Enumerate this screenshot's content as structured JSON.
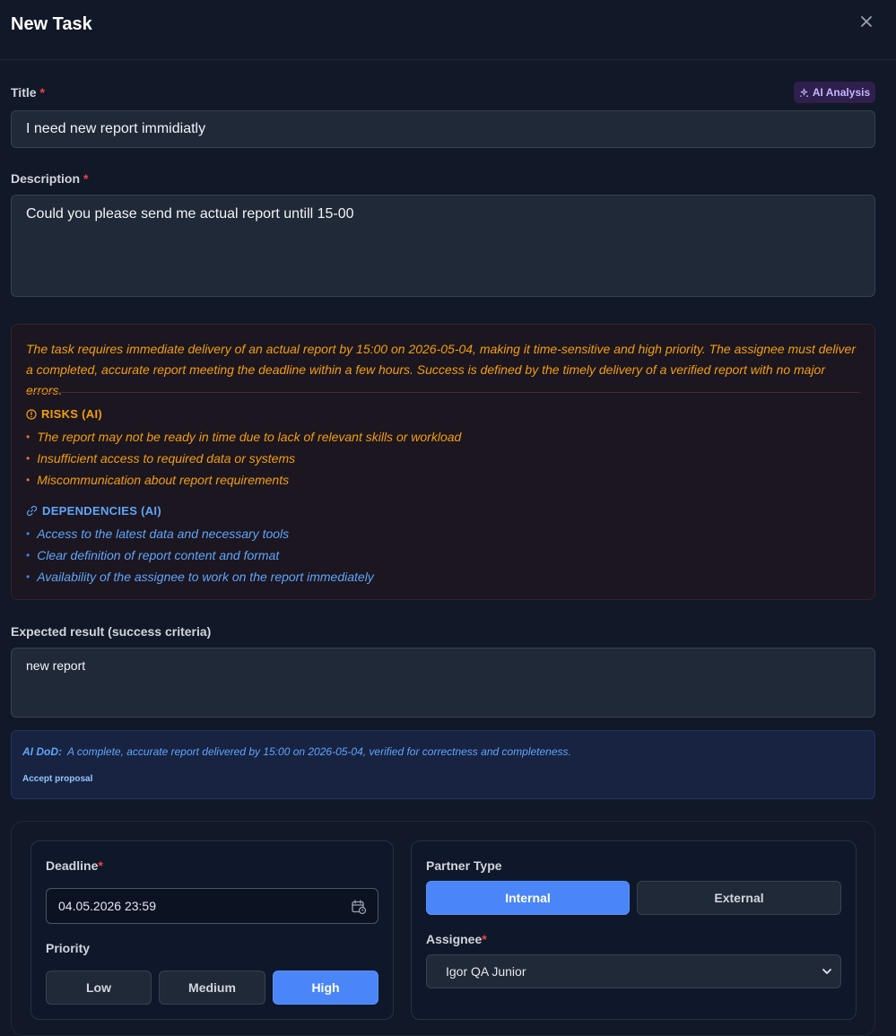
{
  "dialog": {
    "title": "New Task"
  },
  "form": {
    "title_label": "Title",
    "required_mark": "*",
    "ai_button_label": "AI Analysis",
    "title_value": "I need new report immidiatly",
    "description_label": "Description",
    "description_value": "Could you please send me actual report untill 15-00",
    "expected_label": "Expected result (success criteria)",
    "expected_value": "new report"
  },
  "analysis": {
    "summary": "The task requires immediate delivery of an actual report by 15:00 on 2026-05-04, making it time-sensitive and high priority. The assignee must deliver a completed, accurate report meeting the deadline within a few hours. Success is defined by the timely delivery of a verified report with no major errors.",
    "risks_title": "RISKS (AI)",
    "risks": [
      "The report may not be ready in time due to lack of relevant skills or workload",
      "Insufficient access to required data or systems",
      "Miscommunication about report requirements"
    ],
    "dependencies_title": "DEPENDENCIES (AI)",
    "dependencies": [
      "Access to the latest data and necessary tools",
      "Clear definition of report content and format",
      "Availability of the assignee to work on the report immediately"
    ],
    "bullet": "•"
  },
  "dod": {
    "label": "AI DoD:",
    "text": "A complete, accurate report delivered by 15:00 on 2026-05-04, verified for correctness and completeness.",
    "accept_label": "Accept proposal"
  },
  "settings": {
    "deadline_label": "Deadline",
    "deadline_value": "04.05.2026 23:59",
    "priority_label": "Priority",
    "priority_options": [
      "Low",
      "Medium",
      "High"
    ],
    "priority_selected": "High",
    "partner_type_label": "Partner Type",
    "partner_options": [
      "Internal",
      "External"
    ],
    "partner_selected": "Internal",
    "assignee_label": "Assignee",
    "assignee_value": "Igor QA Junior"
  },
  "colors": {
    "accent": "#4a86f7",
    "risk": "#f59e0b",
    "dependency": "#60a5fa",
    "required": "#ef4444",
    "ai_badge": "#c4b5fd"
  },
  "icons": [
    "close-icon",
    "sparkles-icon",
    "alert-circle-icon",
    "link-icon",
    "calendar-icon",
    "chevron-down-icon"
  ]
}
